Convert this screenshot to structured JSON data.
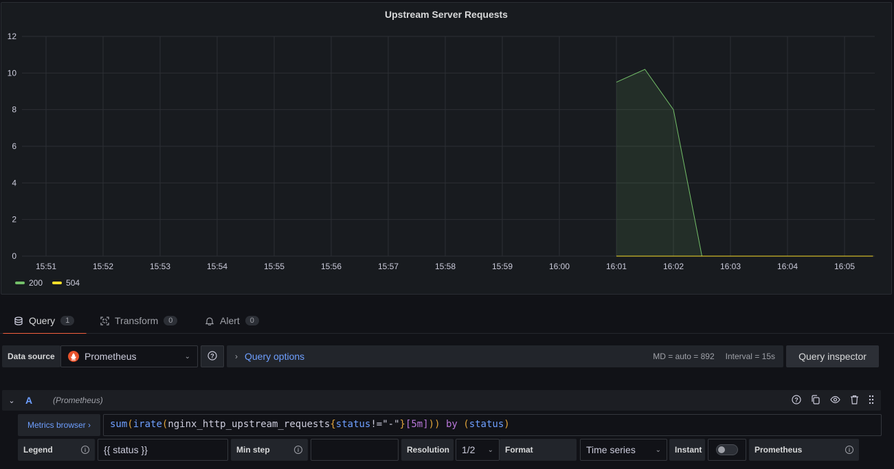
{
  "panel": {
    "title": "Upstream Server Requests"
  },
  "chart_data": {
    "type": "area",
    "title": "Upstream Server Requests",
    "x": [
      "16:01",
      "16:01:30",
      "16:02",
      "16:02:30",
      "16:03",
      "16:03:30",
      "16:04",
      "16:04:30",
      "16:05",
      "16:05:30"
    ],
    "x_ticks": [
      "15:51",
      "15:52",
      "15:53",
      "15:54",
      "15:55",
      "15:56",
      "15:57",
      "15:58",
      "15:59",
      "16:00",
      "16:01",
      "16:02",
      "16:03",
      "16:04",
      "16:05"
    ],
    "y_ticks": [
      "0",
      "2",
      "4",
      "6",
      "8",
      "10",
      "12"
    ],
    "ylim": [
      0,
      12
    ],
    "grid": true,
    "legend_placement": "bottom-left",
    "series": [
      {
        "name": "200",
        "color": "#73bf69",
        "values": [
          9.5,
          10.2,
          8.0,
          0,
          0,
          0,
          0,
          0,
          0,
          0
        ]
      },
      {
        "name": "504",
        "color": "#fade2a",
        "values": [
          0,
          0,
          0,
          0,
          0,
          0,
          0,
          0,
          0,
          0
        ]
      }
    ]
  },
  "tabs": [
    {
      "label": "Query",
      "count": "1",
      "icon": "database-icon"
    },
    {
      "label": "Transform",
      "count": "0",
      "icon": "transform-icon"
    },
    {
      "label": "Alert",
      "count": "0",
      "icon": "bell-icon"
    }
  ],
  "datasource": {
    "label": "Data source",
    "value": "Prometheus"
  },
  "query_options": {
    "label": "Query options",
    "md": "MD = auto = 892",
    "interval": "Interval = 15s"
  },
  "inspector": {
    "label": "Query inspector"
  },
  "query": {
    "ref": "A",
    "datasource": "(Prometheus)",
    "metrics_browser": "Metrics browser ›",
    "expr_parts": {
      "fn1": "sum",
      "p1": "(",
      "fn2": "irate",
      "p2": "(",
      "metric": "nginx_http_upstream_requests",
      "b1": "{",
      "label": "status",
      "op": "!=",
      "str": "\"-\"",
      "b2": "}",
      "dur": "[5m]",
      "p3": "))",
      "kw": " by ",
      "p4": "(",
      "by_label": "status",
      "p5": ")"
    },
    "legend_label": "Legend",
    "legend_value": "{{ status }}",
    "min_step_label": "Min step",
    "min_step_value": "",
    "resolution_label": "Resolution",
    "resolution_value": "1/2",
    "format_label": "Format",
    "format_value": "Time series",
    "instant_label": "Instant",
    "type_label": "Prometheus"
  }
}
